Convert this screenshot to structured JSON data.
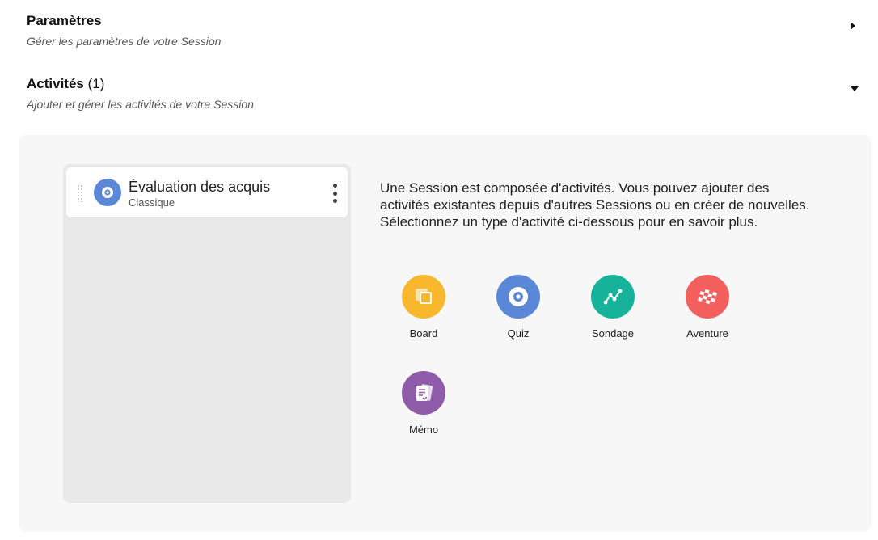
{
  "sections": {
    "params": {
      "title": "Paramètres",
      "subtitle": "Gérer les paramètres de votre Session"
    },
    "activities": {
      "title": "Activités",
      "count": "(1)",
      "subtitle": "Ajouter et gérer les activités de votre Session"
    }
  },
  "activity_list": [
    {
      "title": "Évaluation des acquis",
      "subtitle": "Classique",
      "icon": "quiz-icon"
    }
  ],
  "description": {
    "line1": "Une Session est composée d'activités. Vous pouvez ajouter des activités existantes depuis d'autres Sessions ou en créer de nouvelles.",
    "line2": "Sélectionnez un type d'activité ci-dessous pour en savoir plus."
  },
  "activity_types": [
    {
      "label": "Board",
      "icon": "board-icon",
      "color": "#f9b72e"
    },
    {
      "label": "Quiz",
      "icon": "quiz-icon",
      "color": "#5b87d9"
    },
    {
      "label": "Sondage",
      "icon": "poll-chart-icon",
      "color": "#16b39a"
    },
    {
      "label": "Aventure",
      "icon": "checkered-flag-icon",
      "color": "#f25f5c"
    },
    {
      "label": "Mémo",
      "icon": "memo-cards-icon",
      "color": "#8e5ba8"
    }
  ]
}
